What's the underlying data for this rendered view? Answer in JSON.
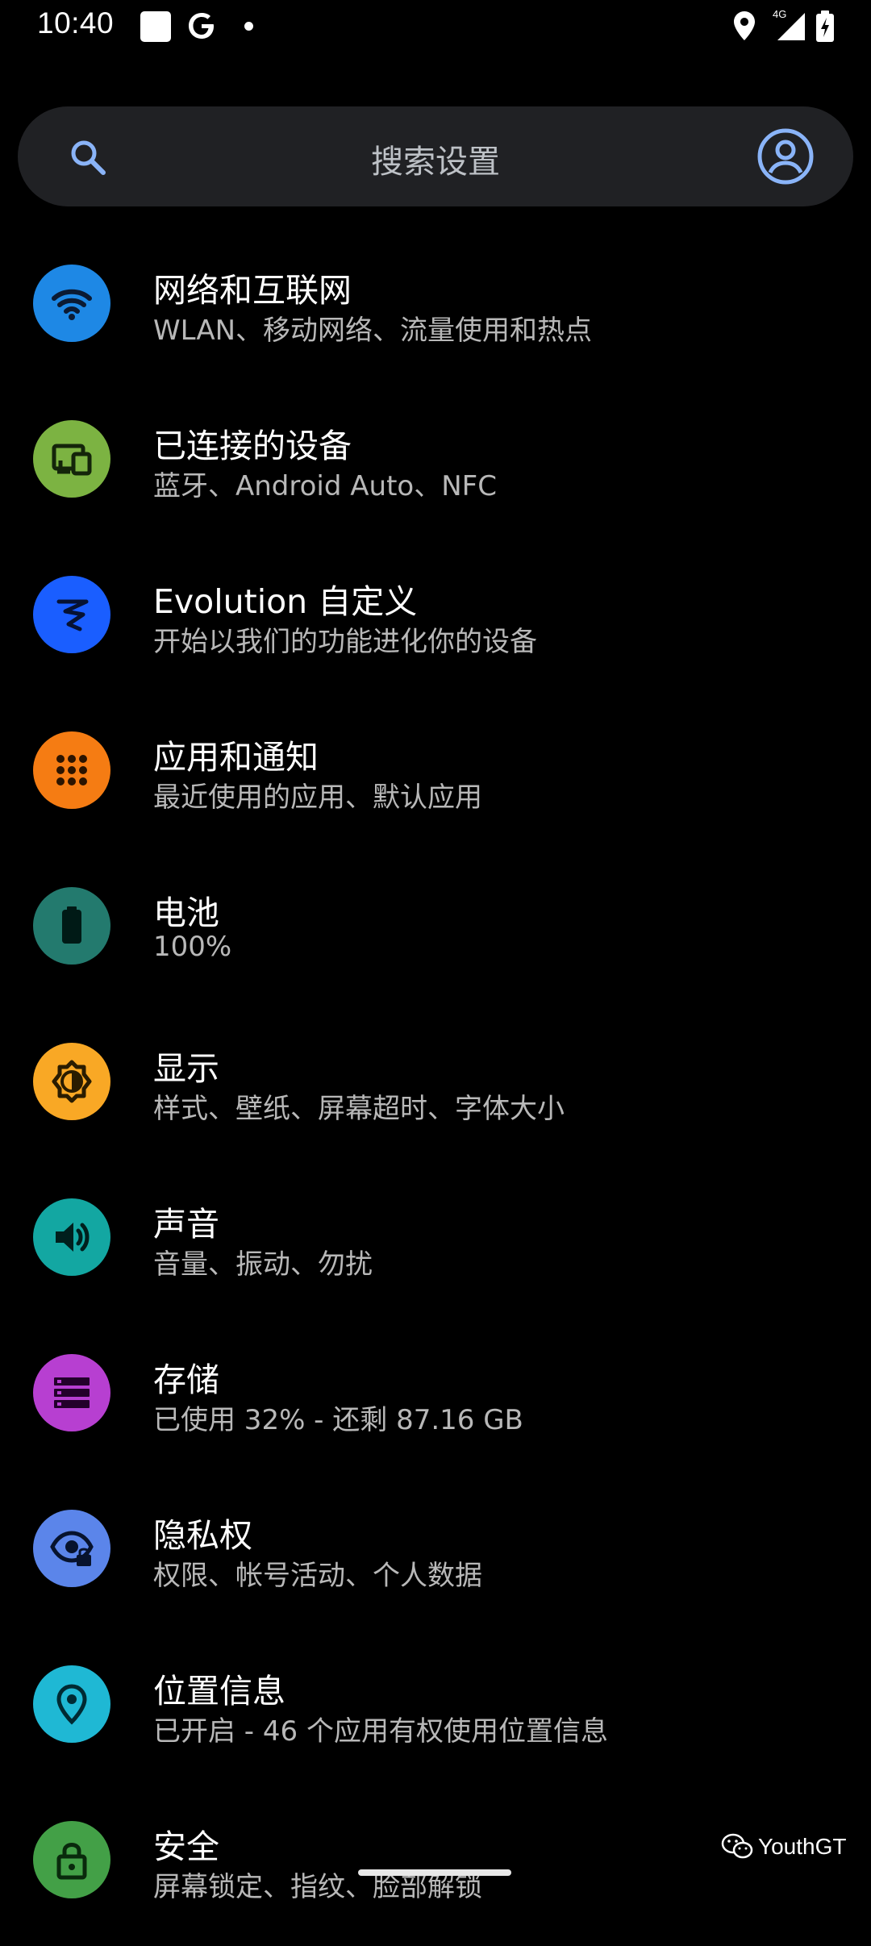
{
  "status_bar": {
    "time": "10:40",
    "network_type": "4G",
    "icons": [
      "notification-square-icon",
      "google-icon",
      "dot-icon",
      "location-icon",
      "signal-icon",
      "battery-charging-icon"
    ]
  },
  "search": {
    "placeholder": "搜索设置",
    "icon": "search-icon",
    "account_icon": "account-circle-icon"
  },
  "items": [
    {
      "title": "网络和互联网",
      "subtitle": "WLAN、移动网络、流量使用和热点",
      "icon": "wifi-icon",
      "color": "#1e88e5"
    },
    {
      "title": "已连接的设备",
      "subtitle": "蓝牙、Android Auto、NFC",
      "icon": "devices-icon",
      "color": "#7cb342"
    },
    {
      "title": "Evolution 自定义",
      "subtitle": "开始以我们的功能进化你的设备",
      "icon": "evolution-icon",
      "color": "#1a5eff"
    },
    {
      "title": "应用和通知",
      "subtitle": "最近使用的应用、默认应用",
      "icon": "apps-grid-icon",
      "color": "#f57c13"
    },
    {
      "title": "电池",
      "subtitle": "100%",
      "icon": "battery-icon",
      "color": "#237a6e"
    },
    {
      "title": "显示",
      "subtitle": "样式、壁纸、屏幕超时、字体大小",
      "icon": "brightness-icon",
      "color": "#f9a825"
    },
    {
      "title": "声音",
      "subtitle": "音量、振动、勿扰",
      "icon": "volume-icon",
      "color": "#13a7a2"
    },
    {
      "title": "存储",
      "subtitle": "已使用 32% - 还剩 87.16 GB",
      "icon": "storage-icon",
      "color": "#b73fd1"
    },
    {
      "title": "隐私权",
      "subtitle": "权限、帐号活动、个人数据",
      "icon": "privacy-eye-icon",
      "color": "#5b85ea"
    },
    {
      "title": "位置信息",
      "subtitle": "已开启 - 46 个应用有权使用位置信息",
      "icon": "location-pin-icon",
      "color": "#1fb8d4"
    },
    {
      "title": "安全",
      "subtitle": "屏幕锁定、指纹、脸部解锁",
      "icon": "lock-icon",
      "color": "#43a047"
    }
  ],
  "watermark": {
    "text": "YouthGT",
    "icon": "wechat-icon"
  }
}
